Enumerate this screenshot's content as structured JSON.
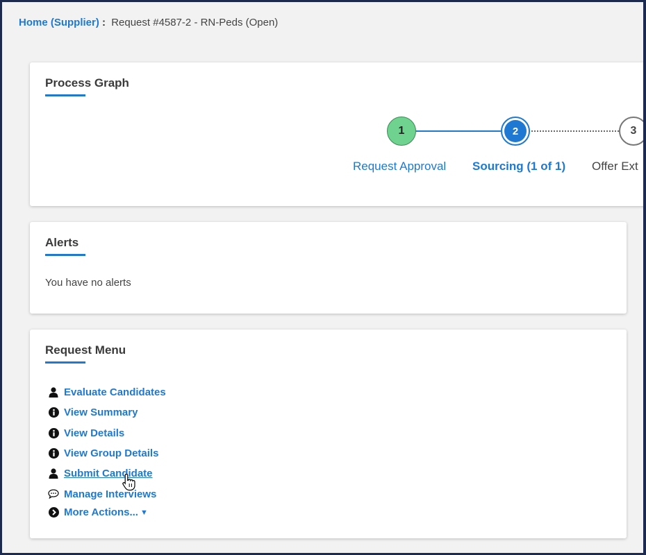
{
  "breadcrumb": {
    "home": "Home (Supplier)",
    "separator": ":",
    "current": "Request #4587-2 - RN-Peds (Open)"
  },
  "process_graph": {
    "title": "Process Graph",
    "steps": [
      {
        "number": "1",
        "label": "Request Approval",
        "state": "complete"
      },
      {
        "number": "2",
        "label": "Sourcing (1 of 1)",
        "state": "current"
      },
      {
        "number": "3",
        "label": "Offer Ext",
        "state": "pending"
      }
    ]
  },
  "alerts": {
    "title": "Alerts",
    "message": "You have no alerts"
  },
  "request_menu": {
    "title": "Request Menu",
    "items": [
      {
        "label": "Evaluate Candidates",
        "icon": "user-icon"
      },
      {
        "label": "View Summary",
        "icon": "info-icon"
      },
      {
        "label": "View Details",
        "icon": "info-icon"
      },
      {
        "label": "View Group Details",
        "icon": "info-icon"
      },
      {
        "label": "Submit Candidate",
        "icon": "user-icon"
      },
      {
        "label": "Manage Interviews",
        "icon": "speech-bubble-icon"
      },
      {
        "label": "More Actions...",
        "icon": "chevron-circle-right-icon"
      }
    ]
  },
  "colors": {
    "accent": "#1f78d1",
    "complete": "#6fd28f",
    "frame": "#1b2a4e"
  }
}
